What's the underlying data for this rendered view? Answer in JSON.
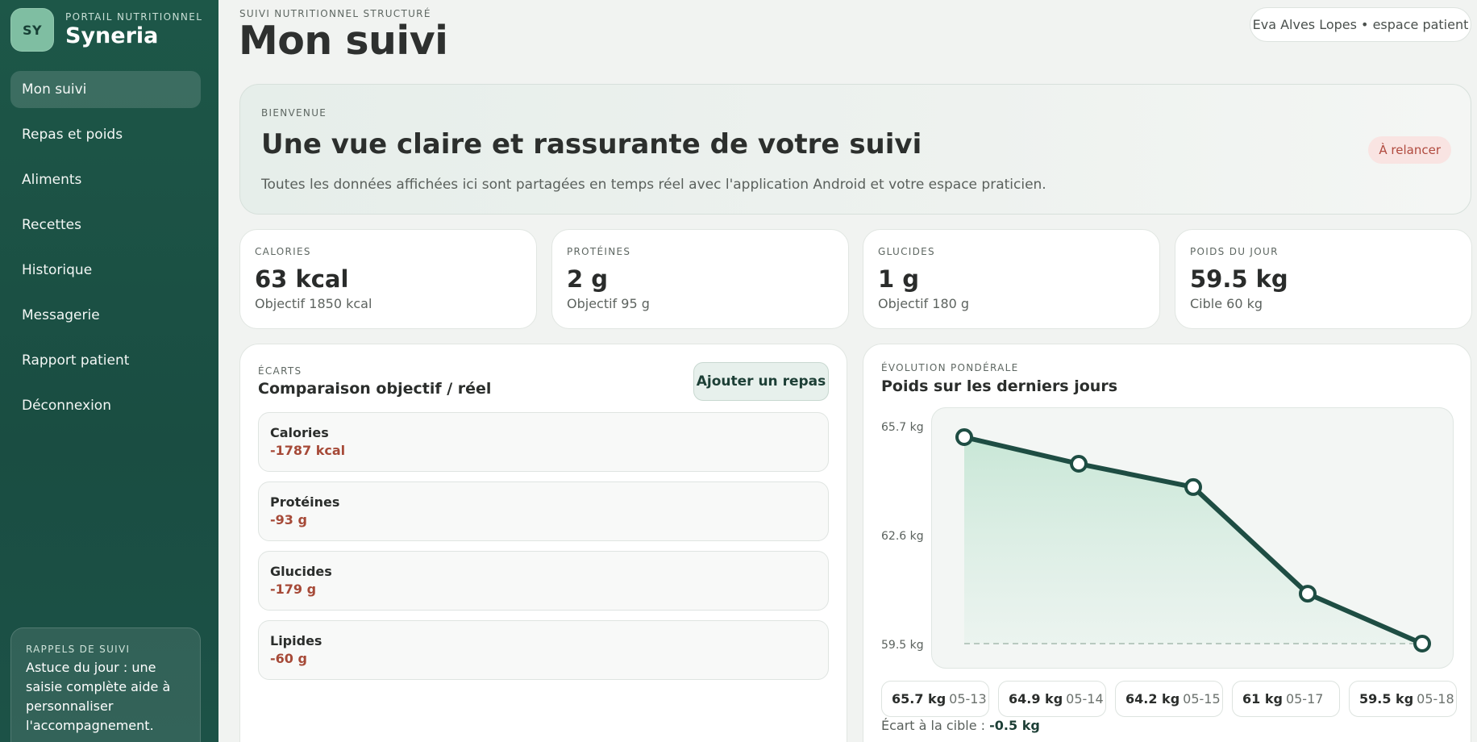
{
  "sidebar": {
    "avatar_initials": "SY",
    "brand_subtitle": "PORTAIL NUTRITIONNEL",
    "brand_name": "Syneria",
    "items": [
      {
        "label": "Mon suivi",
        "active": true
      },
      {
        "label": "Repas et poids"
      },
      {
        "label": "Aliments"
      },
      {
        "label": "Recettes"
      },
      {
        "label": "Historique"
      },
      {
        "label": "Messagerie"
      },
      {
        "label": "Rapport patient"
      },
      {
        "label": "Déconnexion"
      }
    ],
    "tip": {
      "title": "RAPPELS DE SUIVI",
      "text": "Astuce du jour : une saisie complète aide à personnaliser l'accompagnement."
    }
  },
  "header": {
    "eyebrow": "SUIVI NUTRITIONNEL STRUCTURÉ",
    "title": "Mon suivi",
    "user": "Eva Alves Lopes • espace patient"
  },
  "welcome": {
    "eyebrow": "BIENVENUE",
    "title": "Une vue claire et rassurante de votre suivi",
    "text": "Toutes les données affichées ici sont partagées en temps réel avec l'application Android et votre espace praticien.",
    "badge": "À relancer"
  },
  "stats": [
    {
      "label": "CALORIES",
      "value": "63 kcal",
      "sub": "Objectif 1850 kcal"
    },
    {
      "label": "PROTÉINES",
      "value": "2 g",
      "sub": "Objectif 95 g"
    },
    {
      "label": "GLUCIDES",
      "value": "1 g",
      "sub": "Objectif 180 g"
    },
    {
      "label": "POIDS DU JOUR",
      "value": "59.5 kg",
      "sub": "Cible 60 kg"
    }
  ],
  "gaps_panel": {
    "eyebrow": "ÉCARTS",
    "title": "Comparaison objectif / réel",
    "add_button": "Ajouter un repas",
    "rows": [
      {
        "label": "Calories",
        "value": "-1787 kcal"
      },
      {
        "label": "Protéines",
        "value": "-93 g"
      },
      {
        "label": "Glucides",
        "value": "-179 g"
      },
      {
        "label": "Lipides",
        "value": "-60 g"
      }
    ]
  },
  "weight_panel": {
    "eyebrow": "ÉVOLUTION PONDÉRALE",
    "title": "Poids sur les derniers jours",
    "y_ticks": [
      "65.7 kg",
      "62.6 kg",
      "59.5 kg"
    ],
    "chips": [
      {
        "value": "65.7 kg",
        "date": "05-13"
      },
      {
        "value": "64.9 kg",
        "date": "05-14"
      },
      {
        "value": "64.2 kg",
        "date": "05-15"
      },
      {
        "value": "61 kg",
        "date": "05-17"
      },
      {
        "value": "59.5 kg",
        "date": "05-18"
      }
    ],
    "gap_label": "Écart à la cible :",
    "gap_value": "-0.5 kg"
  },
  "chart_data": {
    "type": "line",
    "x": [
      "05-13",
      "05-14",
      "05-15",
      "05-17",
      "05-18"
    ],
    "series": [
      {
        "values": [
          65.7,
          64.9,
          64.2,
          61,
          59.5
        ]
      }
    ],
    "target": 60,
    "ylim": [
      59.5,
      65.7
    ],
    "yticks": [
      65.7,
      62.6,
      59.5
    ],
    "grid": false
  },
  "colors": {
    "sidebar": "#1d5748",
    "line": "#1e4d43",
    "area": "#cfe9dc",
    "negative": "#a64a38",
    "badge_bg": "#f9e4e2",
    "badge_text": "#b04a3e"
  }
}
